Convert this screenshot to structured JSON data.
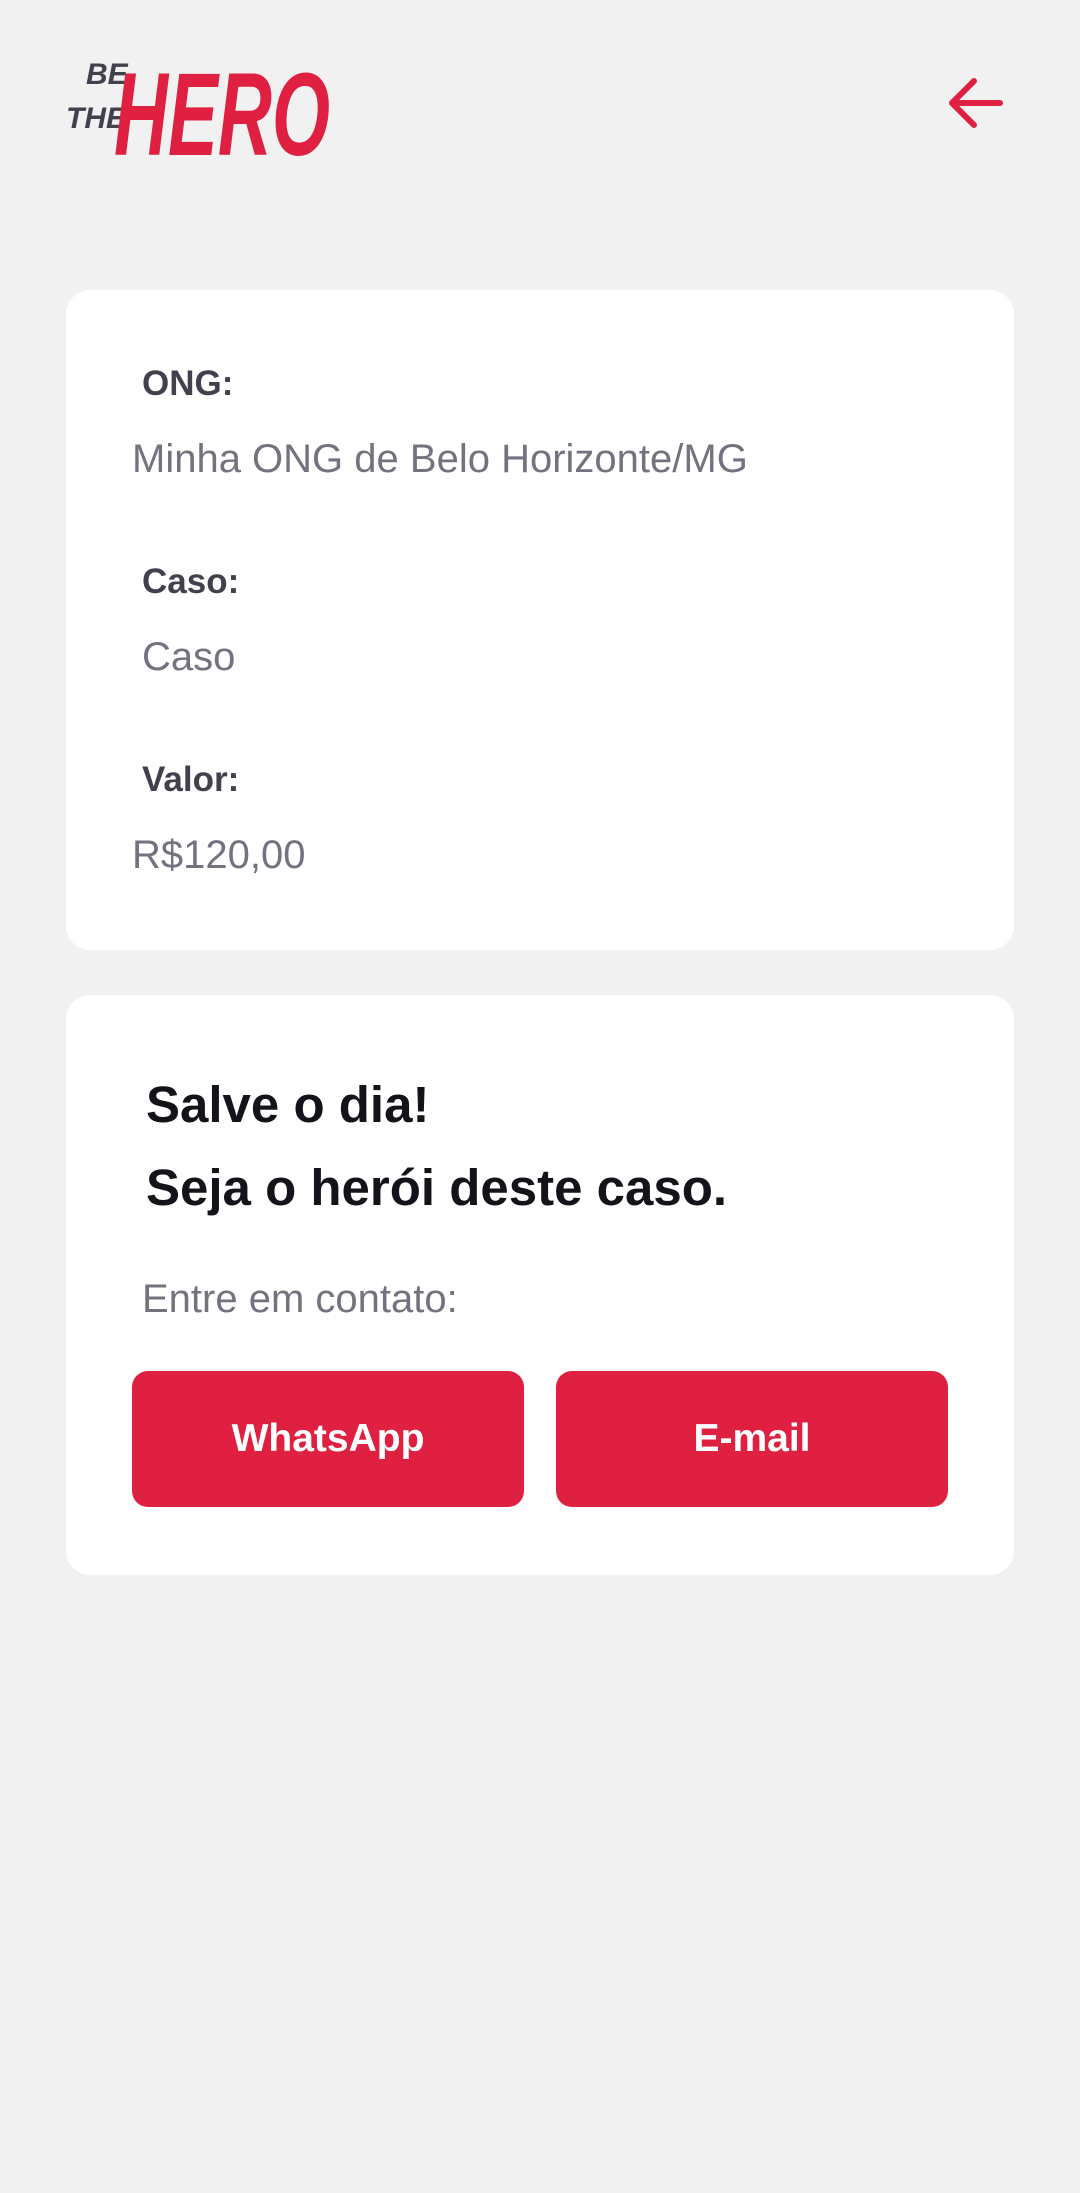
{
  "header": {
    "logo": {
      "line1": "BE",
      "line2": "THE",
      "word": "HERO"
    },
    "back_icon": "arrow-left-icon"
  },
  "incident": {
    "ong_label": "ONG:",
    "ong_value": "Minha ONG de Belo Horizonte/MG",
    "case_label": "Caso:",
    "case_value": "Caso",
    "value_label": "Valor:",
    "value_value": "R$120,00"
  },
  "contact": {
    "title_line1": "Salve o dia!",
    "title_line2": "Seja o herói deste caso.",
    "description": "Entre em contato:",
    "whatsapp_label": "WhatsApp",
    "email_label": "E-mail"
  },
  "colors": {
    "background": "#f1f1f2",
    "card": "#ffffff",
    "accent": "#e02041",
    "label": "#41414d",
    "text_muted": "#737380",
    "title": "#13131a"
  }
}
